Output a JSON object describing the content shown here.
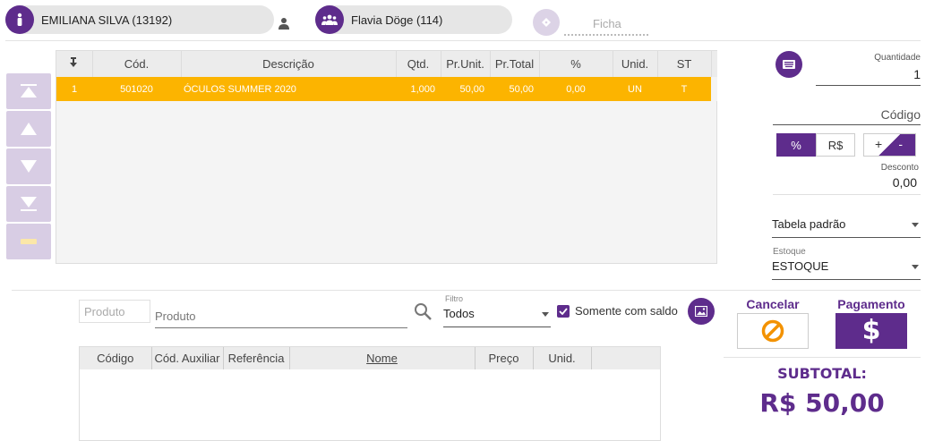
{
  "header": {
    "client_name": "EMILIANA SILVA (13192)",
    "seller_name": "Flavia Döge (114)",
    "ficha_placeholder": "Ficha"
  },
  "items_table": {
    "columns": [
      "Cód.",
      "Descrição",
      "Qtd.",
      "Pr.Unit.",
      "Pr.Total",
      "%",
      "Unid.",
      "ST"
    ],
    "rows": [
      {
        "n": "1",
        "cod": "501020",
        "desc": "ÓCULOS SUMMER 2020",
        "qtd": "1,000",
        "unit": "50,00",
        "total": "50,00",
        "pct": "0,00",
        "unid": "UN",
        "st": "T"
      }
    ]
  },
  "right_panel": {
    "quantidade_label": "Quantidade",
    "quantidade_value": "1",
    "codigo_placeholder": "Código",
    "percent_label": "%",
    "currency_label": "R$",
    "plus_label": "+",
    "minus_label": "-",
    "desconto_label": "Desconto",
    "desconto_value": "0,00",
    "tabela_value": "Tabela padrão",
    "estoque_label": "Estoque",
    "estoque_value": "ESTOQUE"
  },
  "search": {
    "produto_placeholder_small": "Produto",
    "produto_placeholder": "Produto",
    "filtro_label": "Filtro",
    "filtro_value": "Todos",
    "somente_label": "Somente com saldo",
    "somente_checked": true
  },
  "product_grid": {
    "columns": [
      "Código",
      "Cód. Auxiliar",
      "Referência",
      "Nome",
      "Preço",
      "Unid."
    ]
  },
  "actions": {
    "cancelar_label": "Cancelar",
    "pagamento_label": "Pagamento"
  },
  "subtotal": {
    "label": "SUBTOTAL:",
    "value": "R$ 50,00"
  },
  "colors": {
    "brand": "#5e2c8c",
    "selected_row": "#fcb400",
    "cancel_orange": "#f39200"
  }
}
